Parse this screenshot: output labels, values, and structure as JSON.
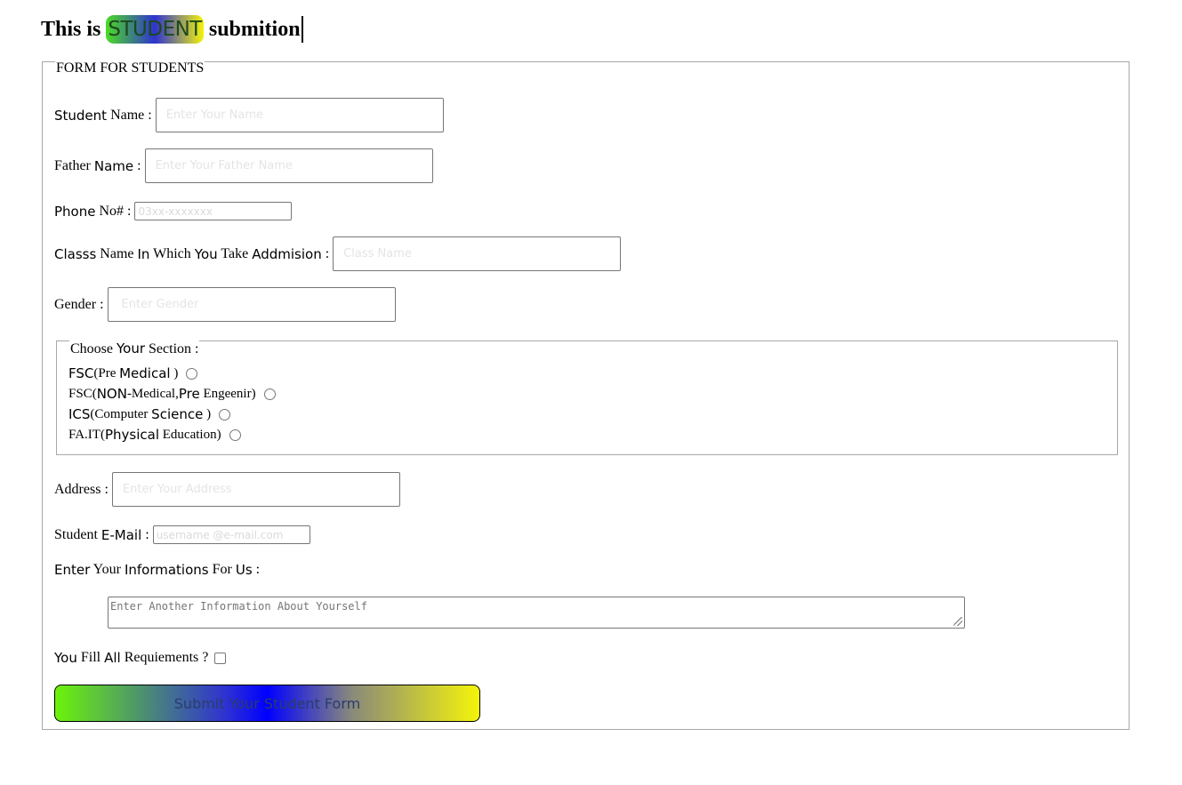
{
  "heading": {
    "prefix": "This is",
    "badge": "STUDENT",
    "suffix": "submition"
  },
  "form": {
    "legend": "FORM FOR STUDENTS",
    "student_name": {
      "label_bold": "Student",
      "label_rest": " Name :",
      "placeholder": "Enter Your Name"
    },
    "father_name": {
      "label_pre": "Father ",
      "label_bold": "Name",
      "label_rest": " :",
      "placeholder": "Enter Your Father Name"
    },
    "phone": {
      "label_bold": "Phone",
      "label_rest": " No# :",
      "placeholder": "03xx-xxxxxxx"
    },
    "class_name": {
      "label_bold1": "Classs",
      "label_mid1": " Name ",
      "label_bold2": "In",
      "label_mid2": " Which ",
      "label_bold3": "You",
      "label_mid3": " Take ",
      "label_bold4": "Addmision",
      "label_rest": " :",
      "placeholder": "Class Name"
    },
    "gender": {
      "label": "Gender :",
      "placeholder": "Enter Gender"
    },
    "section": {
      "legend_pre": "Choose ",
      "legend_bold": "Your",
      "legend_rest": " Section :",
      "options": [
        {
          "a": "FSC",
          "b": "(Pre ",
          "c": "Medical",
          "d": " )"
        },
        {
          "a": "FSC(",
          "b": "NON",
          "c": "-Medical,",
          "d": "Pre",
          "e": " Engeenir)"
        },
        {
          "a": "ICS",
          "b": "(Computer ",
          "c": "Science",
          "d": " )"
        },
        {
          "a": "FA.IT(",
          "b": "Physical",
          "c": " Education)"
        }
      ]
    },
    "address": {
      "label": "Address :",
      "placeholder": "Enter Your Address"
    },
    "email": {
      "label_pre": "Student ",
      "label_bold": "E-Mail",
      "label_rest": " :",
      "placeholder": "username @e-mail.com"
    },
    "info": {
      "label_bold1": "Enter",
      "label_mid1": " Your ",
      "label_bold2": "Informations",
      "label_mid2": " For ",
      "label_bold3": "Us",
      "label_rest": " :",
      "placeholder": "Enter Another Information About Yourself"
    },
    "requirements": {
      "label_bold1": "You",
      "label_mid1": " Fill ",
      "label_bold2": "All",
      "label_rest": " Requiements ?"
    },
    "submit_label": "Submit Your Student Form"
  }
}
